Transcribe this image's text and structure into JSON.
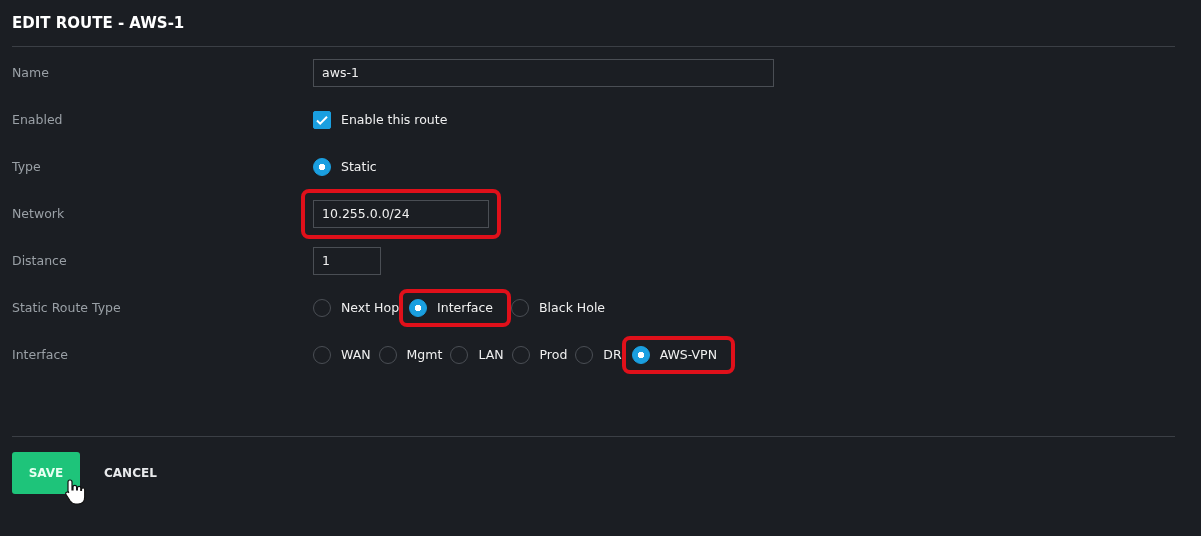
{
  "title": "EDIT ROUTE - AWS-1",
  "fields": [
    {
      "kind": "text",
      "label": "Name",
      "value": "aws-1",
      "highlighted": false
    },
    {
      "kind": "checkbox",
      "label": "Enabled",
      "option": "Enable this route",
      "checked": true
    },
    {
      "kind": "radio",
      "label": "Type",
      "options": [
        {
          "label": "Static",
          "selected": true,
          "highlighted": false
        }
      ]
    },
    {
      "kind": "text",
      "label": "Network",
      "value": "10.255.0.0/24",
      "highlighted": true
    },
    {
      "kind": "text",
      "label": "Distance",
      "value": "1",
      "highlighted": false
    },
    {
      "kind": "radio",
      "label": "Static Route Type",
      "options": [
        {
          "label": "Next Hop",
          "selected": false,
          "highlighted": false
        },
        {
          "label": "Interface",
          "selected": true,
          "highlighted": true
        },
        {
          "label": "Black Hole",
          "selected": false,
          "highlighted": false
        }
      ]
    },
    {
      "kind": "radio",
      "label": "Interface",
      "options": [
        {
          "label": "WAN",
          "selected": false,
          "highlighted": false
        },
        {
          "label": "Mgmt",
          "selected": false,
          "highlighted": false
        },
        {
          "label": "LAN",
          "selected": false,
          "highlighted": false
        },
        {
          "label": "Prod",
          "selected": false,
          "highlighted": false
        },
        {
          "label": "DR",
          "selected": false,
          "highlighted": false
        },
        {
          "label": "AWS-VPN",
          "selected": true,
          "highlighted": true
        }
      ]
    }
  ],
  "buttons": [
    {
      "label": "SAVE",
      "kind": "primary"
    },
    {
      "label": "CANCEL",
      "kind": "plain"
    }
  ]
}
